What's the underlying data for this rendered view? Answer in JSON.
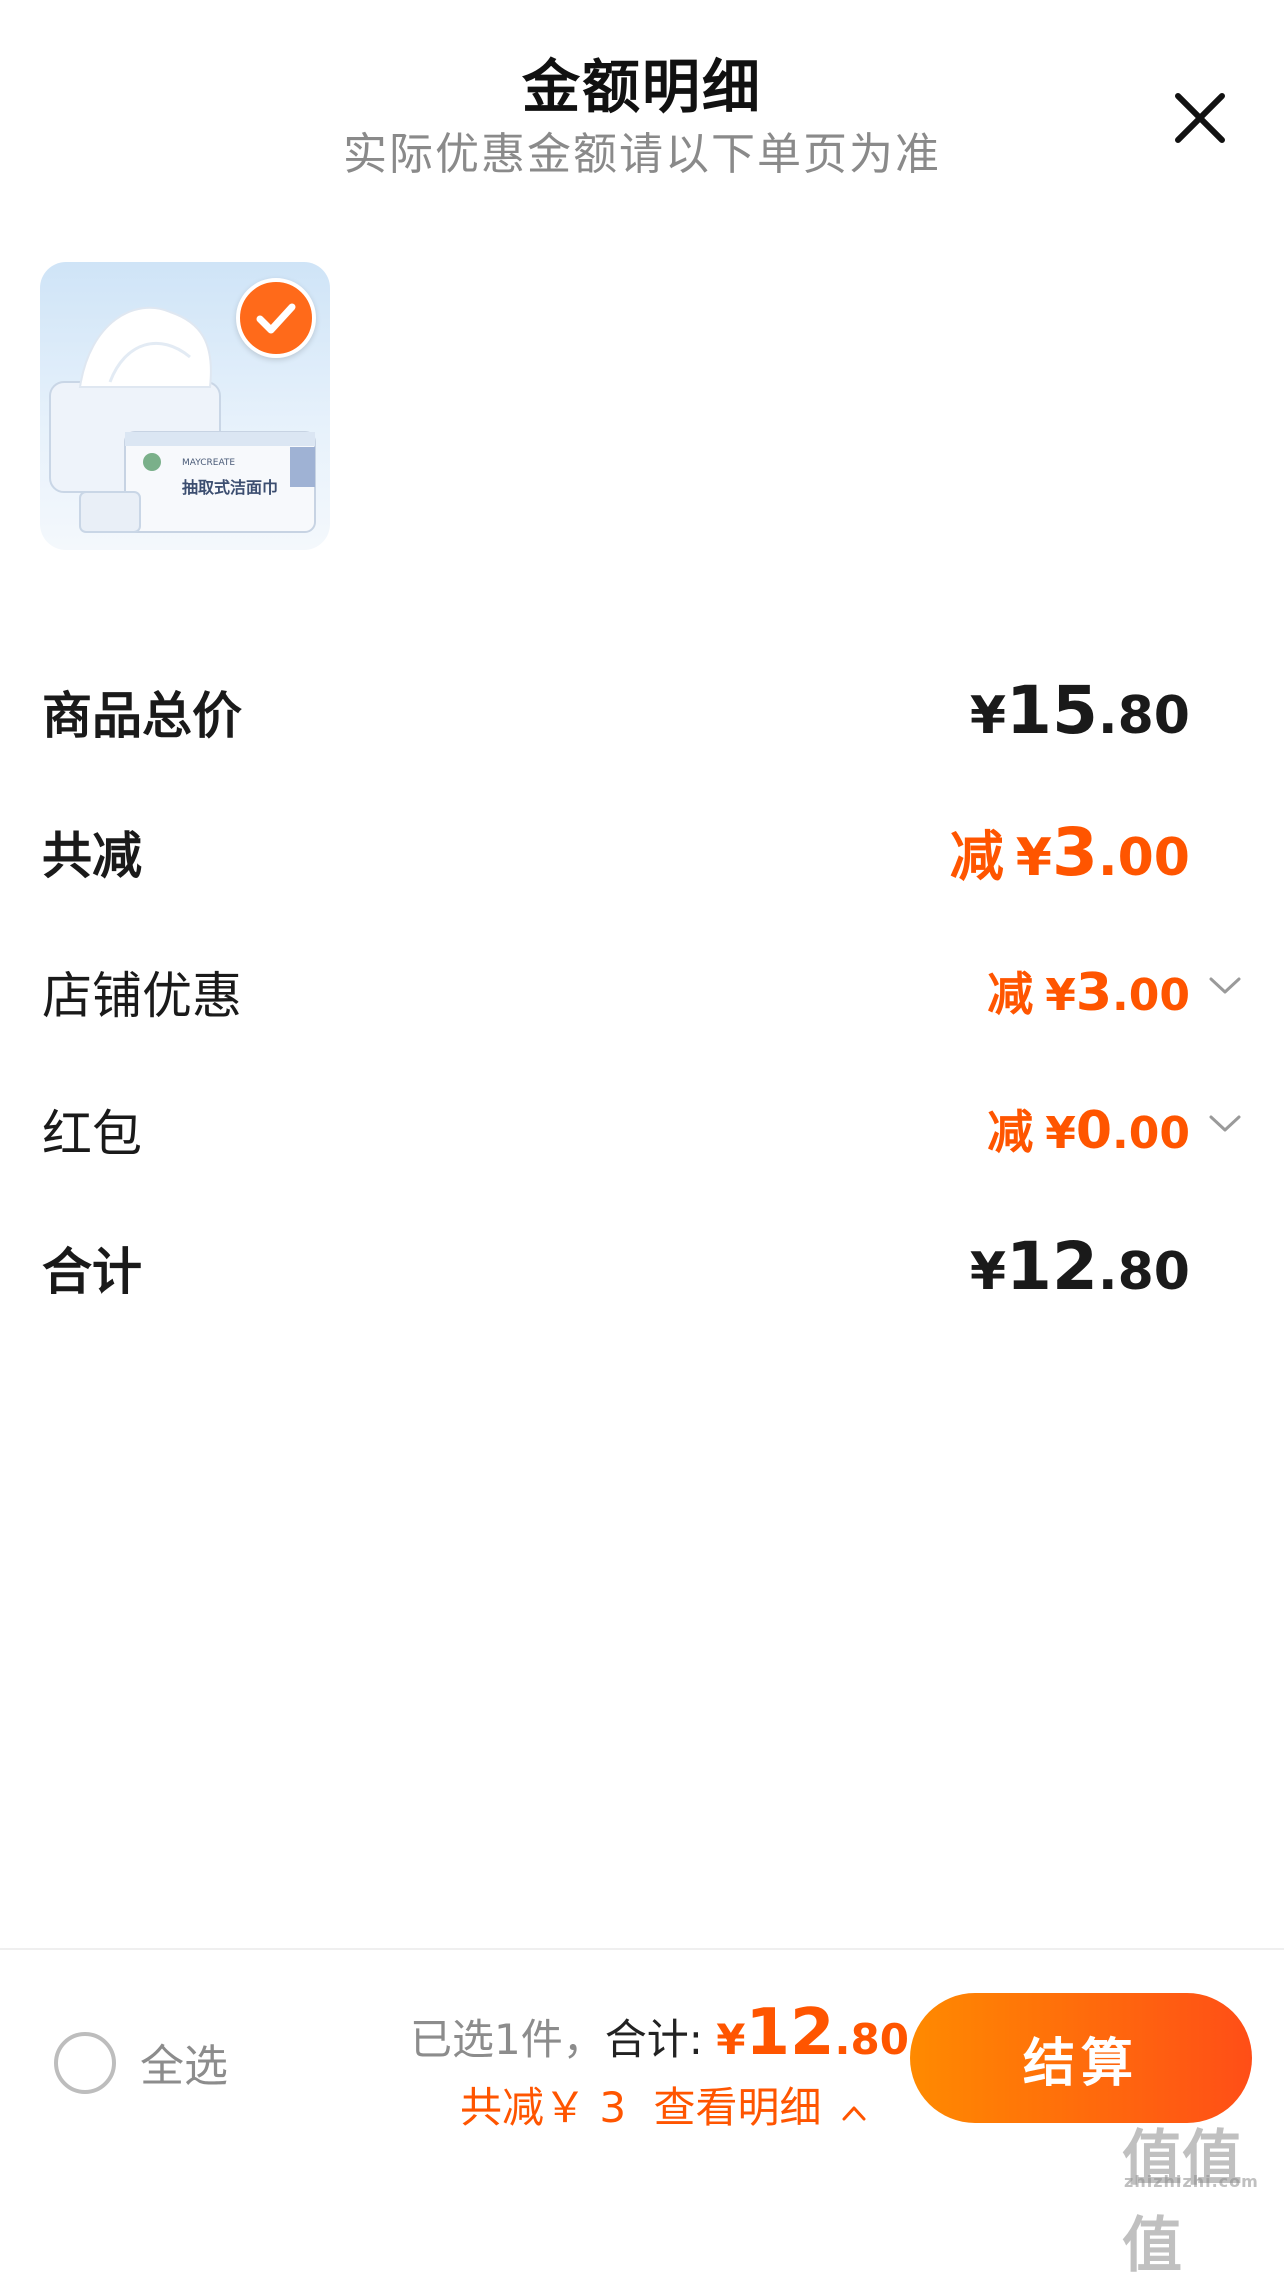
{
  "header": {
    "title": "金额明细",
    "subtitle": "实际优惠金额请以下单页为准"
  },
  "product": {
    "selected": true,
    "brand_text": "MAYCREATE",
    "name_text": "抽取式洁面巾"
  },
  "rows": {
    "total_label": "商品总价",
    "total_currency": "¥",
    "total_int": "15",
    "total_dec": ".80",
    "reduce_label": "共减",
    "reduce_prefix": "减",
    "reduce_currency": "¥",
    "reduce_int": "3",
    "reduce_dec": ".00",
    "shop_label": "店铺优惠",
    "shop_prefix": "减",
    "shop_currency": "¥",
    "shop_int": "3",
    "shop_dec": ".00",
    "redpacket_label": "红包",
    "redpacket_prefix": "减",
    "redpacket_currency": "¥",
    "redpacket_int": "0",
    "redpacket_dec": ".00",
    "sum_label": "合计",
    "sum_currency": "¥",
    "sum_int": "12",
    "sum_dec": ".80"
  },
  "footer": {
    "select_all": "全选",
    "selected_text": "已选1件，",
    "sum_label": "合计:",
    "sum_currency": "¥",
    "sum_int": "12",
    "sum_dec": ".80",
    "reduce_text": "共减￥ 3",
    "detail_link": "查看明细",
    "checkout": "结算"
  },
  "watermark": {
    "text": "值值值",
    "sub": "zhizhizhi.com"
  },
  "colors": {
    "accent": "#ff5500",
    "checkout_start": "#ff8a00",
    "checkout_end": "#ff4e17"
  }
}
